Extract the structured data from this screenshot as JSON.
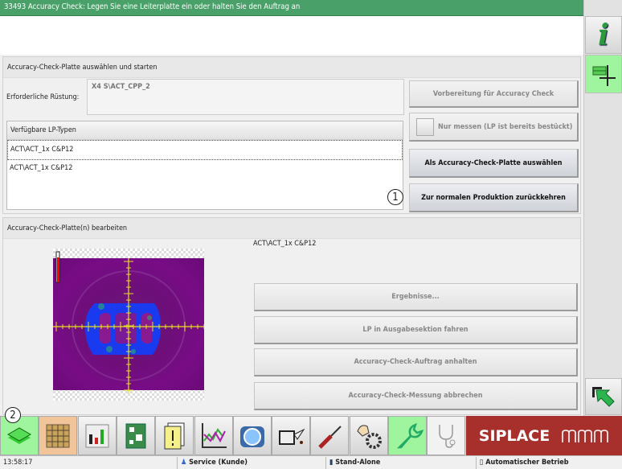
{
  "title": "33493 Accuracy Check: Legen Sie eine Leiterplatte ein oder halten Sie den Auftrag an",
  "panel1": {
    "header": "Accuracy-Check-Platte auswählen und starten",
    "setup_label": "Erforderliche Rüstung:",
    "setup_value": "X4 S\\ACT_CPP_2",
    "list_header": "Verfügbare LP-Typen",
    "list_items": [
      "ACT\\ACT_1x C&P12",
      "ACT\\ACT_1x C&P12"
    ],
    "btn_prepare": "Vorbereitung für Accuracy Check",
    "chk_measure": "Nur messen (LP ist bereits bestückt)",
    "btn_select": "Als Accuracy-Check-Platte auswählen",
    "btn_return": "Zur normalen Produktion zurückkehren",
    "marker1": "1"
  },
  "panel2": {
    "header": "Accuracy-Check-Platte(n) bearbeiten",
    "board_name": "ACT\\ACT_1x C&P12",
    "btn_results": "Ergebnisse...",
    "btn_move": "LP in Ausgabesektion fahren",
    "btn_hold": "Accuracy-Check-Auftrag anhalten",
    "btn_abort": "Accuracy-Check-Messung abbrechen"
  },
  "toolbar": {
    "marker2": "2",
    "icons": [
      "board-stack-icon",
      "feeder-grid-icon",
      "station-view-icon",
      "pcb-icon",
      "warning-documents-icon",
      "chart-icon",
      "camera-icon",
      "oil-can-icon",
      "screwdriver-icon",
      "hand-gear-icon",
      "wrench-icon",
      "stethoscope-icon"
    ],
    "brand": "SIPLACE"
  },
  "status": {
    "time": "13:58:17",
    "user": "Service (Kunde)",
    "mode": "Stand-Alone",
    "operation": "Automatischer Betrieb"
  },
  "colors": {
    "title_bg": "#4aa069",
    "active_green": "#9ef59e",
    "brand_red": "#a8302c"
  }
}
